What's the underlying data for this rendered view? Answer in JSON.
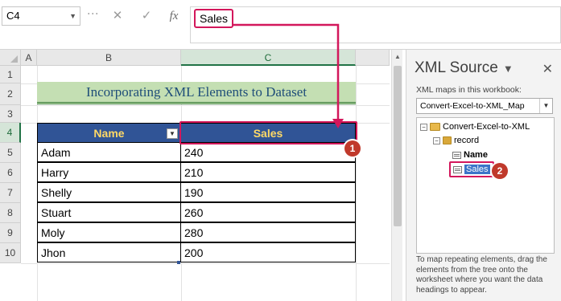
{
  "formula_bar": {
    "name_box": "C4",
    "cancel_icon": "✕",
    "enter_icon": "✓",
    "fx_label": "fx",
    "value": "Sales"
  },
  "sheet": {
    "columns": [
      "A",
      "B",
      "C"
    ],
    "rows": [
      "1",
      "2",
      "3",
      "4",
      "5",
      "6",
      "7",
      "8",
      "9",
      "10"
    ],
    "title": "Incorporating XML Elements to Dataset",
    "headers": [
      "Name",
      "Sales"
    ],
    "data": [
      {
        "name": "Adam",
        "sales": "240"
      },
      {
        "name": "Harry",
        "sales": "210"
      },
      {
        "name": "Shelly",
        "sales": "190"
      },
      {
        "name": "Stuart",
        "sales": "260"
      },
      {
        "name": "Moly",
        "sales": "280"
      },
      {
        "name": "Jhon",
        "sales": "200"
      }
    ]
  },
  "badges": {
    "one": "1",
    "two": "2"
  },
  "xml_source": {
    "title": "XML Source",
    "maps_label": "XML maps in this workbook:",
    "selected_map": "Convert-Excel-to-XML_Map",
    "tree": {
      "root": "Convert-Excel-to-XML",
      "record": "record",
      "name": "Name",
      "sales": "Sales"
    },
    "help_text": "To map repeating elements, drag the elements from the tree onto the worksheet where you want the data headings to appear."
  },
  "colors": {
    "accent": "#d3175b",
    "header_bg": "#305496",
    "header_text": "#ffd966",
    "title_bg": "#c4dfb3"
  }
}
